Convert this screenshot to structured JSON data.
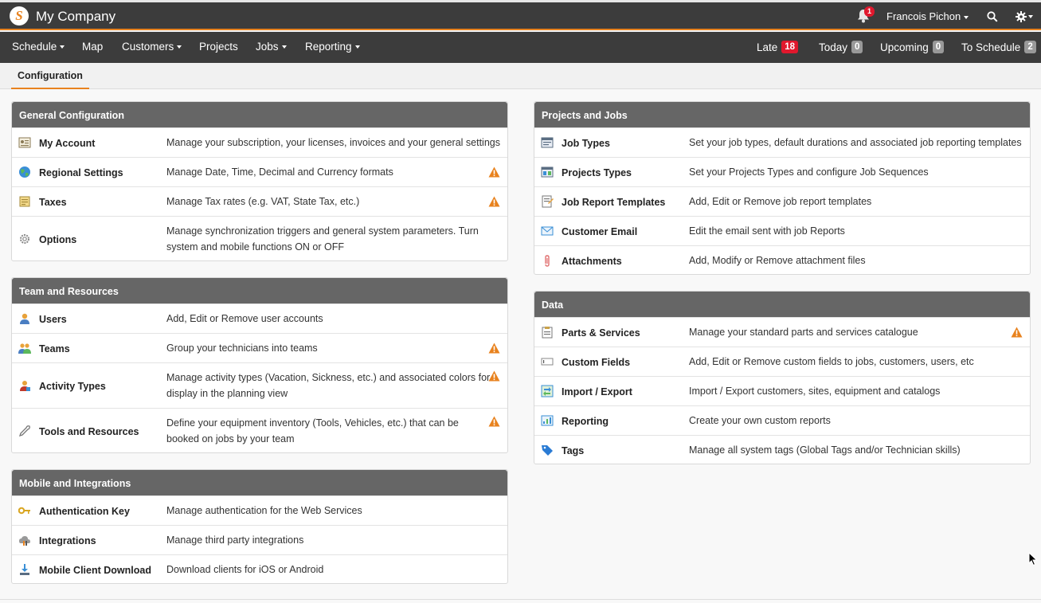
{
  "app": {
    "company": "My Company",
    "logo_letter": "S",
    "user": "Francois Pichon",
    "notification_count": "1"
  },
  "nav": {
    "items": [
      "Schedule",
      "Map",
      "Customers",
      "Projects",
      "Jobs",
      "Reporting"
    ],
    "counters": [
      {
        "label": "Late",
        "count": "18"
      },
      {
        "label": "Today",
        "count": "0"
      },
      {
        "label": "Upcoming",
        "count": "0"
      },
      {
        "label": "To Schedule",
        "count": "2"
      }
    ]
  },
  "subtab": "Configuration",
  "panels": {
    "general": {
      "title": "General Configuration",
      "rows": [
        {
          "icon": "account-card-icon",
          "title": "My Account",
          "desc": "Manage your subscription, your licenses, invoices and your general settings"
        },
        {
          "icon": "globe-icon",
          "title": "Regional Settings",
          "desc": "Manage Date, Time, Decimal and Currency formats"
        },
        {
          "icon": "tax-sheet-icon",
          "title": "Taxes",
          "desc": "Manage Tax rates (e.g. VAT, State Tax, etc.)"
        },
        {
          "icon": "gear-icon",
          "title": "Options",
          "desc": "Manage synchronization triggers and general system parameters. Turn system and mobile functions ON or OFF"
        }
      ]
    },
    "team": {
      "title": "Team and Resources",
      "rows": [
        {
          "icon": "user-icon",
          "title": "Users",
          "desc": "Add, Edit or Remove user accounts"
        },
        {
          "icon": "team-icon",
          "title": "Teams",
          "desc": "Group your technicians into teams"
        },
        {
          "icon": "activity-icon",
          "title": "Activity Types",
          "desc": "Manage activity types (Vacation, Sickness, etc.) and associated colors for display in the planning view"
        },
        {
          "icon": "wrench-icon",
          "title": "Tools and Resources",
          "desc": "Define your equipment inventory (Tools, Vehicles, etc.) that can be booked on jobs by your team"
        }
      ]
    },
    "mobile": {
      "title": "Mobile and Integrations",
      "rows": [
        {
          "icon": "key-icon",
          "title": "Authentication Key",
          "desc": "Manage authentication for the Web Services"
        },
        {
          "icon": "integration-icon",
          "title": "Integrations",
          "desc": "Manage third party integrations"
        },
        {
          "icon": "download-icon",
          "title": "Mobile Client Download",
          "desc": "Download clients for iOS or Android"
        }
      ]
    },
    "projects": {
      "title": "Projects and Jobs",
      "rows": [
        {
          "icon": "job-types-icon",
          "title": "Job Types",
          "desc": "Set your job types, default durations and associated job reporting templates"
        },
        {
          "icon": "project-types-icon",
          "title": "Projects Types",
          "desc": "Set your Projects Types and configure Job Sequences"
        },
        {
          "icon": "report-template-icon",
          "title": "Job Report Templates",
          "desc": "Add, Edit or Remove job report templates"
        },
        {
          "icon": "envelope-icon",
          "title": "Customer Email",
          "desc": "Edit the email sent with job Reports"
        },
        {
          "icon": "paperclip-icon",
          "title": "Attachments",
          "desc": "Add, Modify or Remove attachment files"
        }
      ]
    },
    "data": {
      "title": "Data",
      "rows": [
        {
          "icon": "clipboard-icon",
          "title": "Parts & Services",
          "desc": "Manage your standard parts and services catalogue"
        },
        {
          "icon": "custom-fields-icon",
          "title": "Custom Fields",
          "desc": "Add, Edit or Remove custom fields to jobs, customers, users, etc"
        },
        {
          "icon": "import-export-icon",
          "title": "Import / Export",
          "desc": "Import / Export customers, sites, equipment and catalogs"
        },
        {
          "icon": "reporting-icon",
          "title": "Reporting",
          "desc": "Create your own custom reports"
        },
        {
          "icon": "tag-icon",
          "title": "Tags",
          "desc": "Manage all system tags (Global Tags and/or Technician skills)"
        }
      ]
    }
  },
  "colors": {
    "accent": "#e8821e",
    "topbar": "#3c3c3c",
    "panel_header": "#666666",
    "badge_red": "#e0182d",
    "warning": "#e8821e"
  }
}
